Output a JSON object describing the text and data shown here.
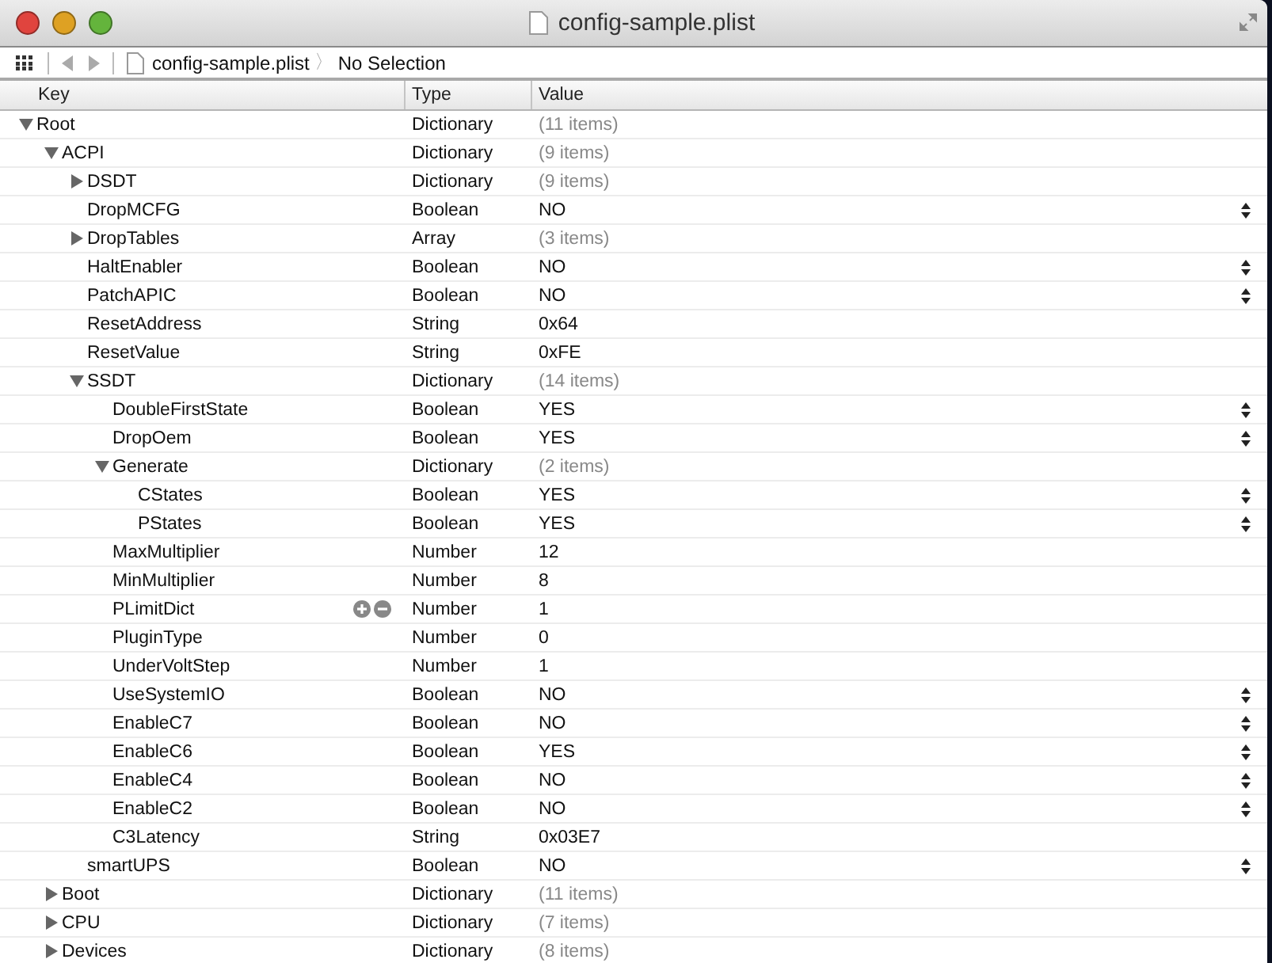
{
  "window": {
    "title": "config-sample.plist"
  },
  "toolbar": {
    "file": "config-sample.plist",
    "separator": "〉",
    "selection": "No Selection"
  },
  "columns": [
    "Key",
    "Type",
    "Value"
  ],
  "tree": [
    {
      "key": "Root",
      "type": "Dictionary",
      "value": "(11 items)",
      "kind": "container",
      "expanded": true,
      "children": [
        {
          "key": "ACPI",
          "type": "Dictionary",
          "value": "(9 items)",
          "kind": "container",
          "expanded": true,
          "children": [
            {
              "key": "DSDT",
              "type": "Dictionary",
              "value": "(9 items)",
              "kind": "container",
              "expanded": false
            },
            {
              "key": "DropMCFG",
              "type": "Boolean",
              "value": "NO",
              "kind": "boolean"
            },
            {
              "key": "DropTables",
              "type": "Array",
              "value": "(3 items)",
              "kind": "container",
              "expanded": false
            },
            {
              "key": "HaltEnabler",
              "type": "Boolean",
              "value": "NO",
              "kind": "boolean"
            },
            {
              "key": "PatchAPIC",
              "type": "Boolean",
              "value": "NO",
              "kind": "boolean"
            },
            {
              "key": "ResetAddress",
              "type": "String",
              "value": "0x64",
              "kind": "plain"
            },
            {
              "key": "ResetValue",
              "type": "String",
              "value": "0xFE",
              "kind": "plain"
            },
            {
              "key": "SSDT",
              "type": "Dictionary",
              "value": "(14 items)",
              "kind": "container",
              "expanded": true,
              "children": [
                {
                  "key": "DoubleFirstState",
                  "type": "Boolean",
                  "value": "YES",
                  "kind": "boolean"
                },
                {
                  "key": "DropOem",
                  "type": "Boolean",
                  "value": "YES",
                  "kind": "boolean"
                },
                {
                  "key": "Generate",
                  "type": "Dictionary",
                  "value": "(2 items)",
                  "kind": "container",
                  "expanded": true,
                  "children": [
                    {
                      "key": "CStates",
                      "type": "Boolean",
                      "value": "YES",
                      "kind": "boolean"
                    },
                    {
                      "key": "PStates",
                      "type": "Boolean",
                      "value": "YES",
                      "kind": "boolean"
                    }
                  ]
                },
                {
                  "key": "MaxMultiplier",
                  "type": "Number",
                  "value": "12",
                  "kind": "plain"
                },
                {
                  "key": "MinMultiplier",
                  "type": "Number",
                  "value": "8",
                  "kind": "plain"
                },
                {
                  "key": "PLimitDict",
                  "type": "Number",
                  "value": "1",
                  "kind": "plain",
                  "hovered": true
                },
                {
                  "key": "PluginType",
                  "type": "Number",
                  "value": "0",
                  "kind": "plain"
                },
                {
                  "key": "UnderVoltStep",
                  "type": "Number",
                  "value": "1",
                  "kind": "plain"
                },
                {
                  "key": "UseSystemIO",
                  "type": "Boolean",
                  "value": "NO",
                  "kind": "boolean"
                },
                {
                  "key": "EnableC7",
                  "type": "Boolean",
                  "value": "NO",
                  "kind": "boolean"
                },
                {
                  "key": "EnableC6",
                  "type": "Boolean",
                  "value": "YES",
                  "kind": "boolean"
                },
                {
                  "key": "EnableC4",
                  "type": "Boolean",
                  "value": "NO",
                  "kind": "boolean"
                },
                {
                  "key": "EnableC2",
                  "type": "Boolean",
                  "value": "NO",
                  "kind": "boolean"
                },
                {
                  "key": "C3Latency",
                  "type": "String",
                  "value": "0x03E7",
                  "kind": "plain"
                }
              ]
            },
            {
              "key": "smartUPS",
              "type": "Boolean",
              "value": "NO",
              "kind": "boolean"
            }
          ]
        },
        {
          "key": "Boot",
          "type": "Dictionary",
          "value": "(11 items)",
          "kind": "container",
          "expanded": false
        },
        {
          "key": "CPU",
          "type": "Dictionary",
          "value": "(7 items)",
          "kind": "container",
          "expanded": false
        },
        {
          "key": "Devices",
          "type": "Dictionary",
          "value": "(8 items)",
          "kind": "container",
          "expanded": false
        }
      ]
    }
  ]
}
